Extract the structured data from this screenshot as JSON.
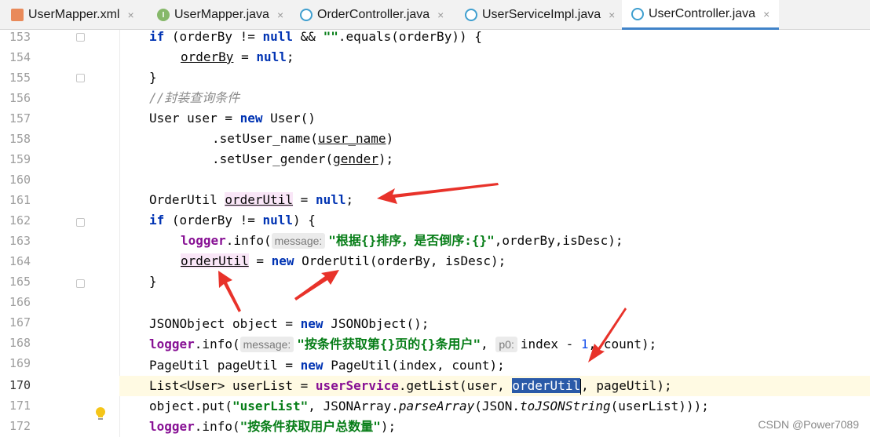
{
  "tabs": [
    {
      "label": "UserMapper.xml",
      "icon": "xml-file-icon",
      "active": false
    },
    {
      "label": "UserMapper.java",
      "icon": "interface-icon",
      "active": false
    },
    {
      "label": "OrderController.java",
      "icon": "class-icon",
      "active": false
    },
    {
      "label": "UserServiceImpl.java",
      "icon": "class-icon",
      "active": false
    },
    {
      "label": "UserController.java",
      "icon": "class-icon",
      "active": true
    }
  ],
  "close_glyph": "×",
  "line_numbers": [
    "153",
    "154",
    "155",
    "156",
    "157",
    "158",
    "159",
    "160",
    "161",
    "162",
    "163",
    "164",
    "165",
    "166",
    "167",
    "168",
    "169",
    "170",
    "171",
    "172"
  ],
  "code": {
    "l153": {
      "kw_if": "if",
      "a": " (orderBy != ",
      "kw_null": "null",
      "b": " && ",
      "str": "\"\"",
      "c": ".equals(orderBy)) {"
    },
    "l154": {
      "var": "orderBy",
      "a": " = ",
      "kw_null": "null",
      "b": ";"
    },
    "l155": {
      "a": "}"
    },
    "l156": {
      "comment": "//封装查询条件"
    },
    "l157": {
      "a": "User user = ",
      "kw_new": "new",
      "b": " User()"
    },
    "l158": {
      "a": ".setUser_name(",
      "var": "user_name",
      "b": ")"
    },
    "l159": {
      "a": ".setUser_gender(",
      "var": "gender",
      "b": ");"
    },
    "l161": {
      "a": "OrderUtil ",
      "var": "orderUtil",
      "b": " = ",
      "kw_null": "null",
      "c": ";"
    },
    "l162": {
      "kw_if": "if",
      "a": " (orderBy != ",
      "kw_null": "null",
      "b": ") {"
    },
    "l163": {
      "field": "logger",
      "a": ".info(",
      "hint": "message:",
      "str": "\"根据{}排序，是否倒序:{}\"",
      "b": ",orderBy,isDesc);"
    },
    "l164": {
      "var": "orderUtil",
      "a": " = ",
      "kw_new": "new",
      "b": " OrderUtil(orderBy, isDesc);"
    },
    "l165": {
      "a": "}"
    },
    "l167": {
      "a": "JSONObject object = ",
      "kw_new": "new",
      "b": " JSONObject();"
    },
    "l168": {
      "field": "logger",
      "a": ".info(",
      "hint1": "message:",
      "str": "\"按条件获取第{}页的{}条用户\"",
      "b": ", ",
      "hint2": "p0:",
      "c": "index - ",
      "num": "1",
      "d": ", count);"
    },
    "l169": {
      "a": "PageUtil pageUtil = ",
      "kw_new": "new",
      "b": " PageUtil(index, count);"
    },
    "l170": {
      "a": "List<User> userList = ",
      "field": "userService",
      "b": ".getList(user, ",
      "sel": "orderUtil",
      "c": ", pageUtil);"
    },
    "l171": {
      "a": "object.put(",
      "str": "\"userList\"",
      "b": ", JSONArray.",
      "m1": "parseArray",
      "c": "(JSON.",
      "m2": "toJSONString",
      "d": "(userList)));"
    },
    "l172": {
      "field": "logger",
      "a": ".info(",
      "str": "\"按条件获取用户总数量\"",
      "b": ");"
    }
  },
  "colors": {
    "annotation_arrow": "#e8322a",
    "selection": "#2a5aa8",
    "keyword": "#0033b3",
    "string": "#067d17"
  },
  "watermark": "CSDN @Power7089"
}
